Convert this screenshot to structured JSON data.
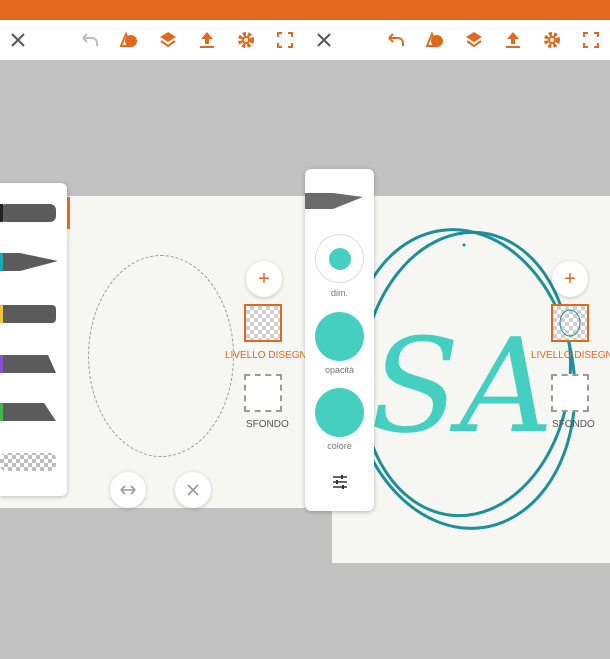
{
  "colors": {
    "accent": "#e0691e",
    "teal": "#45cfc0",
    "drawing_teal": "#1c8f9a"
  },
  "toolbar_icons": [
    "close-icon",
    "undo-icon",
    "shapes-icon",
    "layers-icon",
    "share-icon",
    "settings-icon",
    "fullscreen-icon"
  ],
  "layers": {
    "drawing_label": "LIVELLO DISEGNO",
    "background_label": "SFONDO",
    "add_layer_glyph": "+"
  },
  "tools": [
    "dark-gray-pen",
    "teal-marker",
    "yellow-brush",
    "purple-brush",
    "green-brush",
    "eraser"
  ],
  "brush_panel": {
    "size_label": "dim.",
    "opacity_label": "opacità",
    "color_label": "colore"
  },
  "drawing_letters": "SA"
}
